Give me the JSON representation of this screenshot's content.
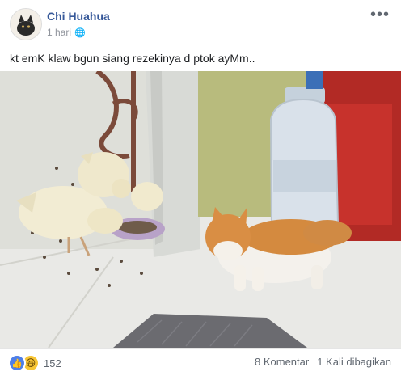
{
  "post": {
    "author": "Chi Huahua",
    "time": "1 hari",
    "caption": "kt emK klaw bgun siang rezekinya d ptok ayMm.."
  },
  "footer": {
    "reaction_count": "152",
    "comments": "8 Komentar",
    "shares": "1 Kali dibagikan"
  },
  "icons": [
    "globe-icon",
    "more-options-icon",
    "like-reaction-icon",
    "haha-reaction-icon"
  ],
  "colors": {
    "author_link": "#365899",
    "like_blue": "#4e7fe8",
    "haha_yellow": "#f7c534",
    "meta_gray": "#90949c"
  }
}
